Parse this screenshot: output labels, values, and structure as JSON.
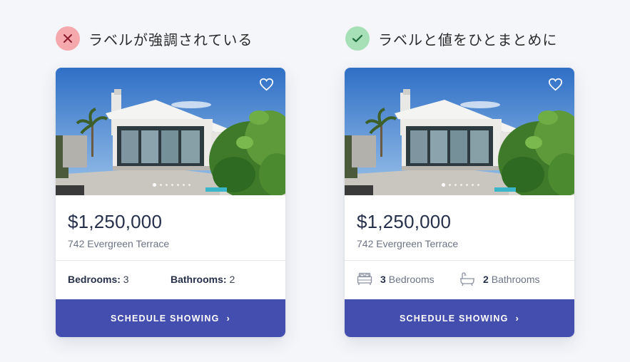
{
  "verdicts": {
    "bad": {
      "text": "ラベルが強調されている",
      "icon": "x-icon",
      "color": "#f6a9ad"
    },
    "good": {
      "text": "ラベルと値をひとまとめに",
      "icon": "check-icon",
      "color": "#a7e0b7"
    }
  },
  "listing": {
    "price": "$1,250,000",
    "address": "742 Evergreen Terrace",
    "cta_label": "SCHEDULE SHOWING",
    "cta_chevron": "›",
    "accent_color": "#434eae",
    "photo_dots": 7,
    "active_dot": 1
  },
  "card_bad": {
    "bedrooms_label": "Bedrooms:",
    "bedrooms_value": "3",
    "bathrooms_label": "Bathrooms:",
    "bathrooms_value": "2"
  },
  "card_good": {
    "bedrooms_value": "3",
    "bedrooms_label": "Bedrooms",
    "bedrooms_icon": "bed-icon",
    "bathrooms_value": "2",
    "bathrooms_label": "Bathrooms",
    "bathrooms_icon": "bathtub-icon"
  }
}
